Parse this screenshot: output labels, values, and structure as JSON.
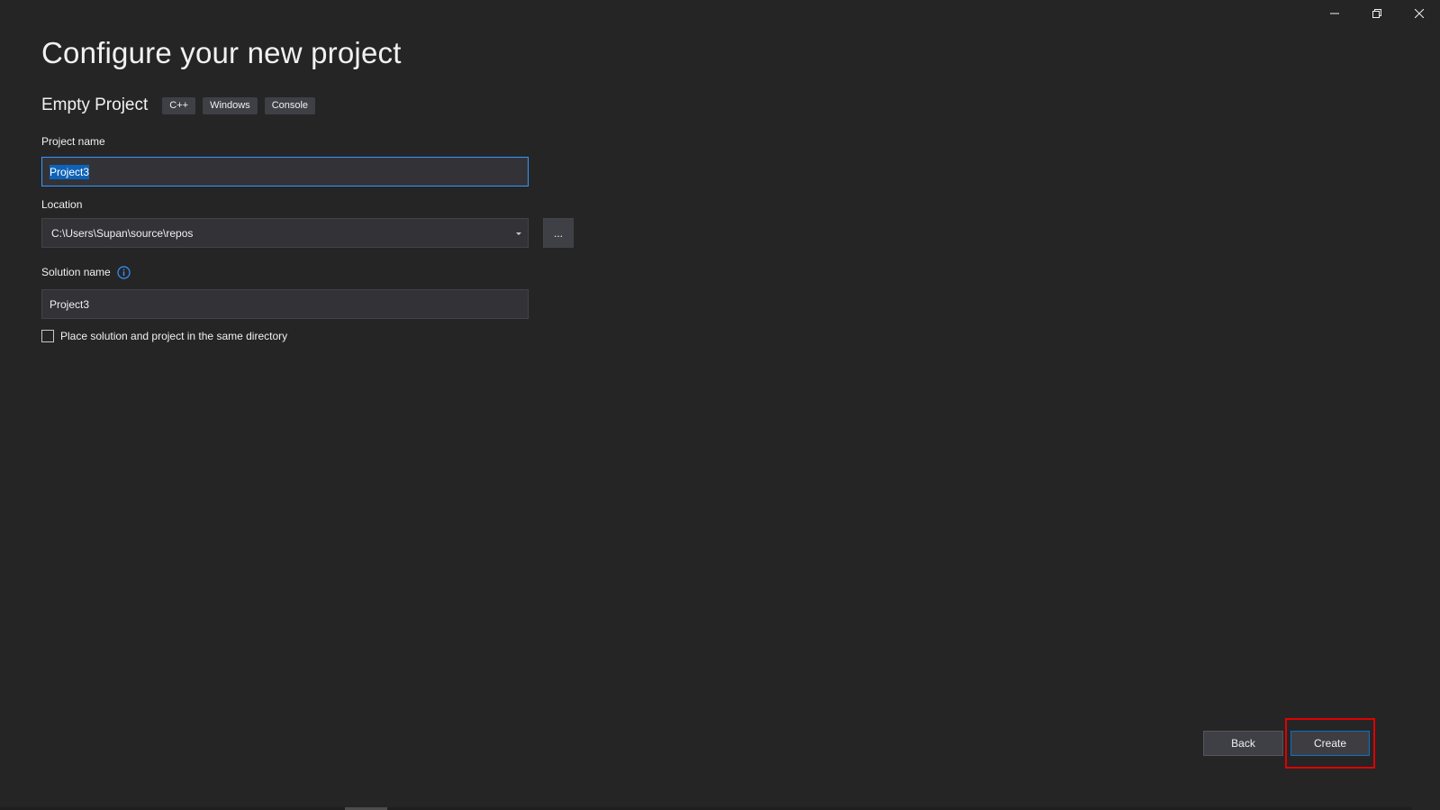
{
  "window": {
    "controls": {
      "minimize_icon": "minimize-icon",
      "restore_icon": "restore-icon",
      "close_icon": "close-icon"
    }
  },
  "header": {
    "title": "Configure your new project"
  },
  "template": {
    "name": "Empty Project",
    "tags": [
      "C++",
      "Windows",
      "Console"
    ]
  },
  "form": {
    "project_name": {
      "label": "Project name",
      "value": "Project3"
    },
    "location": {
      "label": "Location",
      "value": "C:\\Users\\Supan\\source\\repos",
      "browse_label": "..."
    },
    "solution_name": {
      "label": "Solution name",
      "value": "Project3",
      "info_icon": "info-icon"
    },
    "same_directory": {
      "label": "Place solution and project in the same directory",
      "checked": false
    }
  },
  "footer": {
    "back_label": "Back",
    "create_label": "Create"
  },
  "colors": {
    "background": "#252526",
    "accent": "#0e70c0",
    "highlight": "#e00000"
  }
}
